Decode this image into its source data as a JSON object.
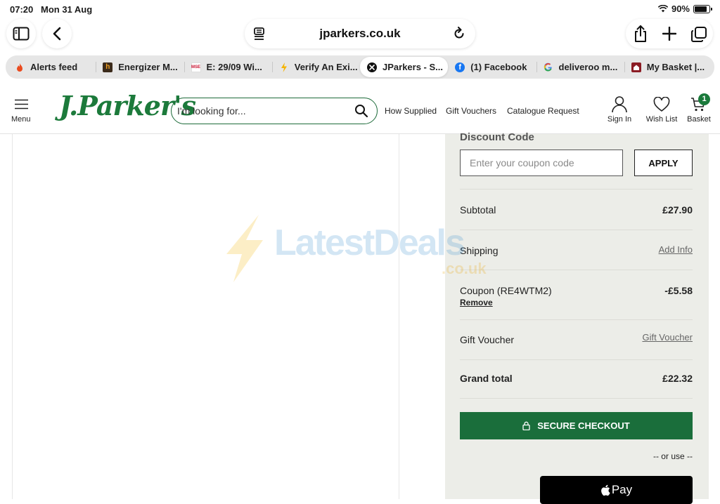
{
  "status_bar": {
    "time": "07:20",
    "date": "Mon 31 Aug",
    "battery": "90%",
    "battery_level": 0.9
  },
  "browser": {
    "url": "jparkers.co.uk",
    "tabs": [
      {
        "label": "Alerts feed",
        "icon": "flame-icon"
      },
      {
        "label": "Energizer M...",
        "icon": "h-logo-icon"
      },
      {
        "label": "E: 29/09 Wi...",
        "icon": "mse-icon"
      },
      {
        "label": "Verify An Exi...",
        "icon": "bolt-icon"
      },
      {
        "label": "JParkers - S...",
        "icon": "close-icon",
        "active": true
      },
      {
        "label": "(1) Facebook",
        "icon": "facebook-icon"
      },
      {
        "label": "deliveroo m...",
        "icon": "google-icon"
      },
      {
        "label": "My Basket |...",
        "icon": "home-icon"
      }
    ]
  },
  "header": {
    "menu_label": "Menu",
    "logo_text": "J.Parker's",
    "search_placeholder": "I'm looking for...",
    "nav": [
      "How Supplied",
      "Gift Vouchers",
      "Catalogue Request"
    ],
    "sign_in": "Sign In",
    "wish_list": "Wish List",
    "basket": "Basket",
    "basket_count": "1",
    "brand_color": "#1c7a3b"
  },
  "summary": {
    "discount_title": "Discount Code",
    "coupon_placeholder": "Enter your coupon code",
    "apply_label": "APPLY",
    "subtotal_label": "Subtotal",
    "subtotal_value": "£27.90",
    "shipping_label": "Shipping",
    "shipping_link": "Add Info",
    "coupon_label": "Coupon (RE4WTM2)",
    "coupon_value": "-£5.58",
    "remove_label": "Remove",
    "voucher_label": "Gift Voucher",
    "voucher_link": "Gift Voucher",
    "grand_total_label": "Grand total",
    "grand_total_value": "£22.32",
    "checkout_label": "SECURE CHECKOUT",
    "or_use": "-- or use --",
    "applepay_label": "Pay",
    "checkout_color": "#1a6e3b"
  },
  "watermark": {
    "main": "LatestDeals",
    "sub": ".co.uk"
  }
}
